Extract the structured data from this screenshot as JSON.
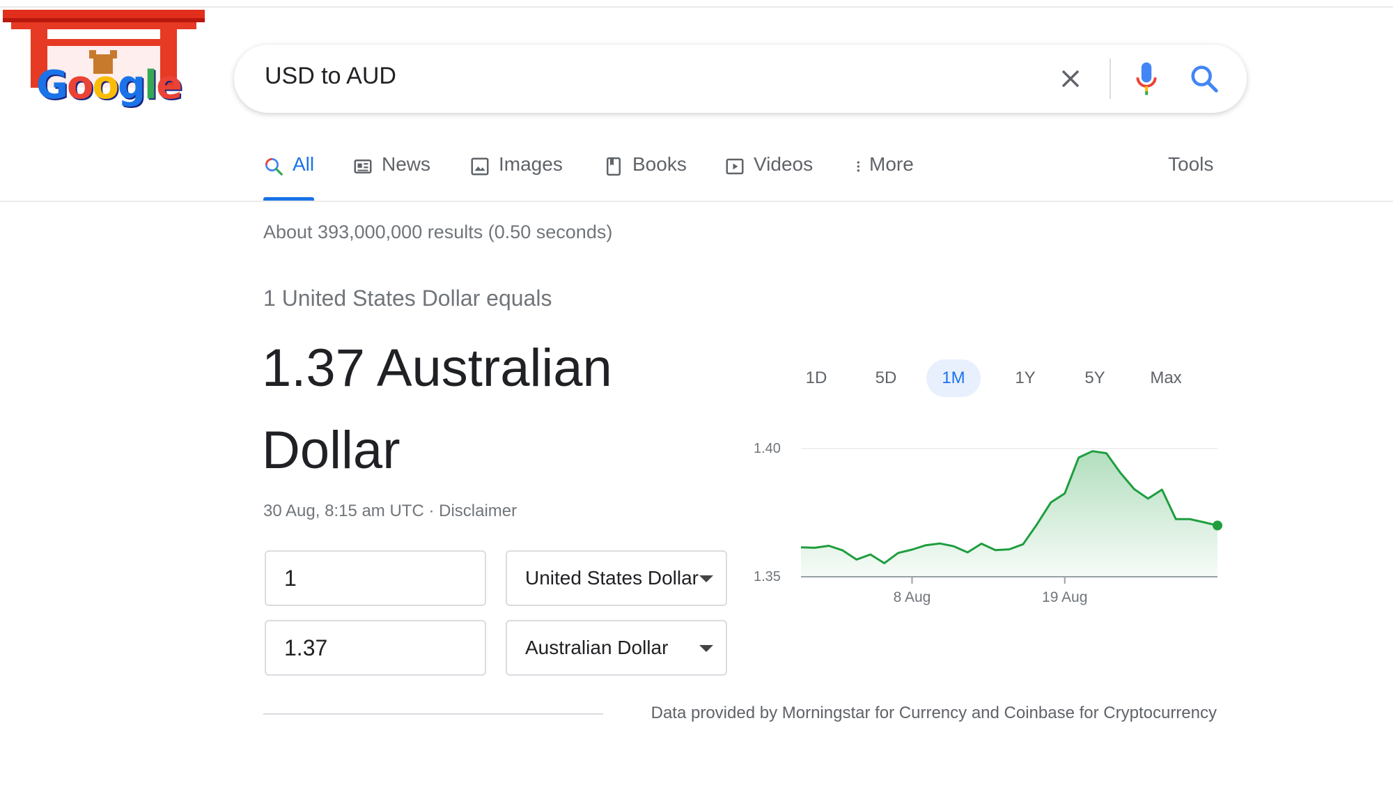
{
  "logo": {
    "letters": [
      "G",
      "o",
      "o",
      "g",
      "l",
      "e"
    ],
    "colors": [
      "#1a73e8",
      "#ea4335",
      "#fbbc05",
      "#1a73e8",
      "#34a853",
      "#ea4335"
    ]
  },
  "search": {
    "query": "USD to AUD"
  },
  "tabs": [
    {
      "label": "All",
      "icon": "search-icon",
      "active": true
    },
    {
      "label": "News",
      "icon": "news-icon"
    },
    {
      "label": "Images",
      "icon": "image-icon"
    },
    {
      "label": "Books",
      "icon": "book-icon"
    },
    {
      "label": "Videos",
      "icon": "video-icon"
    },
    {
      "label": "More",
      "icon": "more-dots-icon"
    }
  ],
  "tools_label": "Tools",
  "result_stats": "About 393,000,000 results (0.50 seconds)",
  "converter": {
    "equals_label": "1 United States Dollar equals",
    "value_line1": "1.37 Australian",
    "value_line2": "Dollar",
    "timestamp": "30 Aug, 8:15 am UTC · ",
    "disclaimer": "Disclaimer",
    "from_amount": "1",
    "from_currency": "United States Dollar",
    "to_amount": "1.37",
    "to_currency": "Australian Dollar"
  },
  "attribution": "Data provided by Morningstar for Currency and Coinbase for Cryptocurrency",
  "colors": {
    "accent": "#1a73e8",
    "line": "#1e9e3e",
    "fill_top": "#c8e9cf"
  },
  "chart_data": {
    "type": "area",
    "ranges": [
      "1D",
      "5D",
      "1M",
      "1Y",
      "5Y",
      "Max"
    ],
    "active_range": "1M",
    "y_ticks": [
      "1.40",
      "1.35"
    ],
    "ylim": [
      1.35,
      1.4
    ],
    "x_ticks": [
      {
        "day": 8,
        "label": "8 Aug"
      },
      {
        "day": 19,
        "label": "19 Aug"
      }
    ],
    "x_range": [
      0,
      30
    ],
    "x": [
      0,
      1,
      2,
      3,
      4,
      5,
      6,
      7,
      8,
      9,
      10,
      11,
      12,
      13,
      14,
      15,
      16,
      17,
      18,
      19,
      20,
      21,
      22,
      23,
      24,
      25,
      26,
      27,
      28,
      29,
      30
    ],
    "values": [
      1.3615,
      1.3613,
      1.3621,
      1.3603,
      1.3567,
      1.3587,
      1.3553,
      1.3593,
      1.3606,
      1.3623,
      1.363,
      1.3619,
      1.3595,
      1.3629,
      1.3604,
      1.3607,
      1.3627,
      1.3705,
      1.379,
      1.3825,
      1.3965,
      1.399,
      1.3982,
      1.3906,
      1.3842,
      1.3805,
      1.384,
      1.3725,
      1.3725,
      1.3713,
      1.37
    ]
  }
}
